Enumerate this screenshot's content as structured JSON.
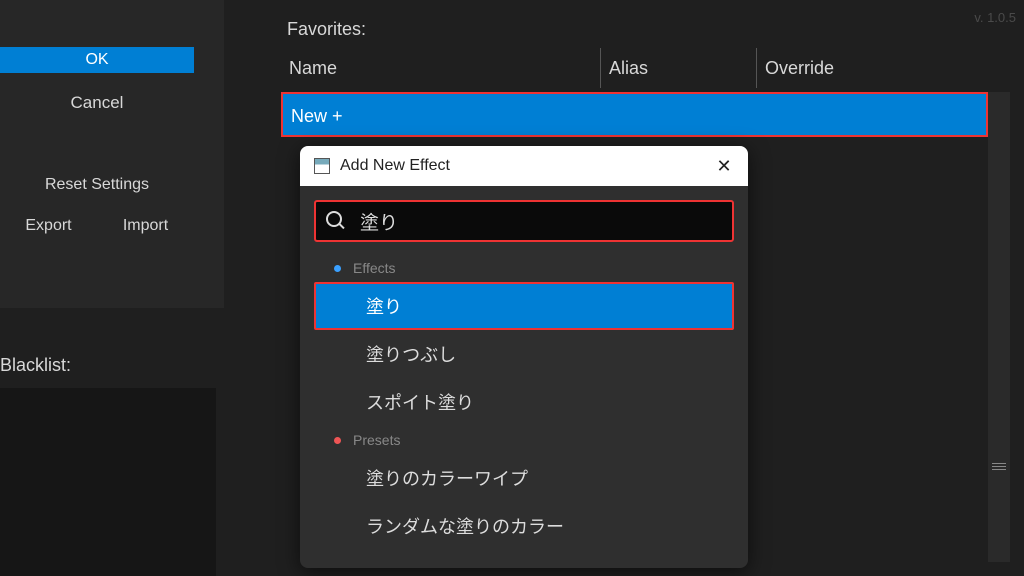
{
  "version": "v. 1.0.5",
  "left": {
    "ok": "OK",
    "cancel": "Cancel",
    "reset": "Reset Settings",
    "export": "Export",
    "import": "Import",
    "blacklist": "Blacklist:"
  },
  "favorites": {
    "label": "Favorites:",
    "columns": {
      "name": "Name",
      "alias": "Alias",
      "override": "Override"
    },
    "newRow": "New +"
  },
  "dialog": {
    "title": "Add New Effect",
    "searchValue": "塗り",
    "groups": {
      "effects": "Effects",
      "presets": "Presets"
    },
    "effectsItems": [
      "塗り",
      "塗りつぶし",
      "スポイト塗り"
    ],
    "presetsItems": [
      "塗りのカラーワイプ",
      "ランダムな塗りのカラー"
    ],
    "selectedIndex": 0
  }
}
